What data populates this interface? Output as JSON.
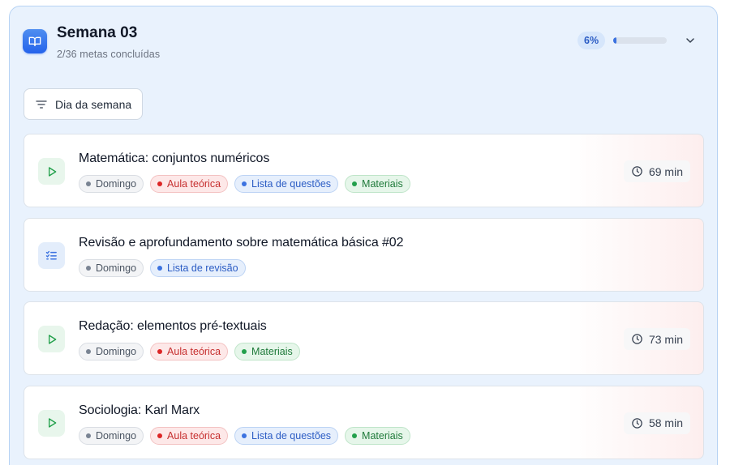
{
  "header": {
    "title": "Semana 03",
    "subtitle": "2/36 metas concluídas",
    "progress_label": "6%",
    "progress_fraction": 0.06,
    "icon": "book-open-icon",
    "accent": "#2563eb"
  },
  "filter": {
    "label": "Dia da semana",
    "icon": "filter-icon"
  },
  "tasks": [
    {
      "title": "Matemática: conjuntos numéricos",
      "icon": "play-icon",
      "tags": [
        {
          "label": "Domingo",
          "color": "gray"
        },
        {
          "label": "Aula teórica",
          "color": "red"
        },
        {
          "label": "Lista de questões",
          "color": "blue"
        },
        {
          "label": "Materiais",
          "color": "green"
        }
      ],
      "duration": "69 min"
    },
    {
      "title": "Revisão e aprofundamento sobre matemática básica #02",
      "icon": "checklist-icon",
      "tags": [
        {
          "label": "Domingo",
          "color": "gray"
        },
        {
          "label": "Lista de revisão",
          "color": "blue"
        }
      ],
      "duration": ""
    },
    {
      "title": "Redação: elementos pré-textuais",
      "icon": "play-icon",
      "tags": [
        {
          "label": "Domingo",
          "color": "gray"
        },
        {
          "label": "Aula teórica",
          "color": "red"
        },
        {
          "label": "Materiais",
          "color": "green"
        }
      ],
      "duration": "73 min"
    },
    {
      "title": "Sociologia: Karl Marx",
      "icon": "play-icon",
      "tags": [
        {
          "label": "Domingo",
          "color": "gray"
        },
        {
          "label": "Aula teórica",
          "color": "red"
        },
        {
          "label": "Lista de questões",
          "color": "blue"
        },
        {
          "label": "Materiais",
          "color": "green"
        }
      ],
      "duration": "58 min"
    }
  ]
}
